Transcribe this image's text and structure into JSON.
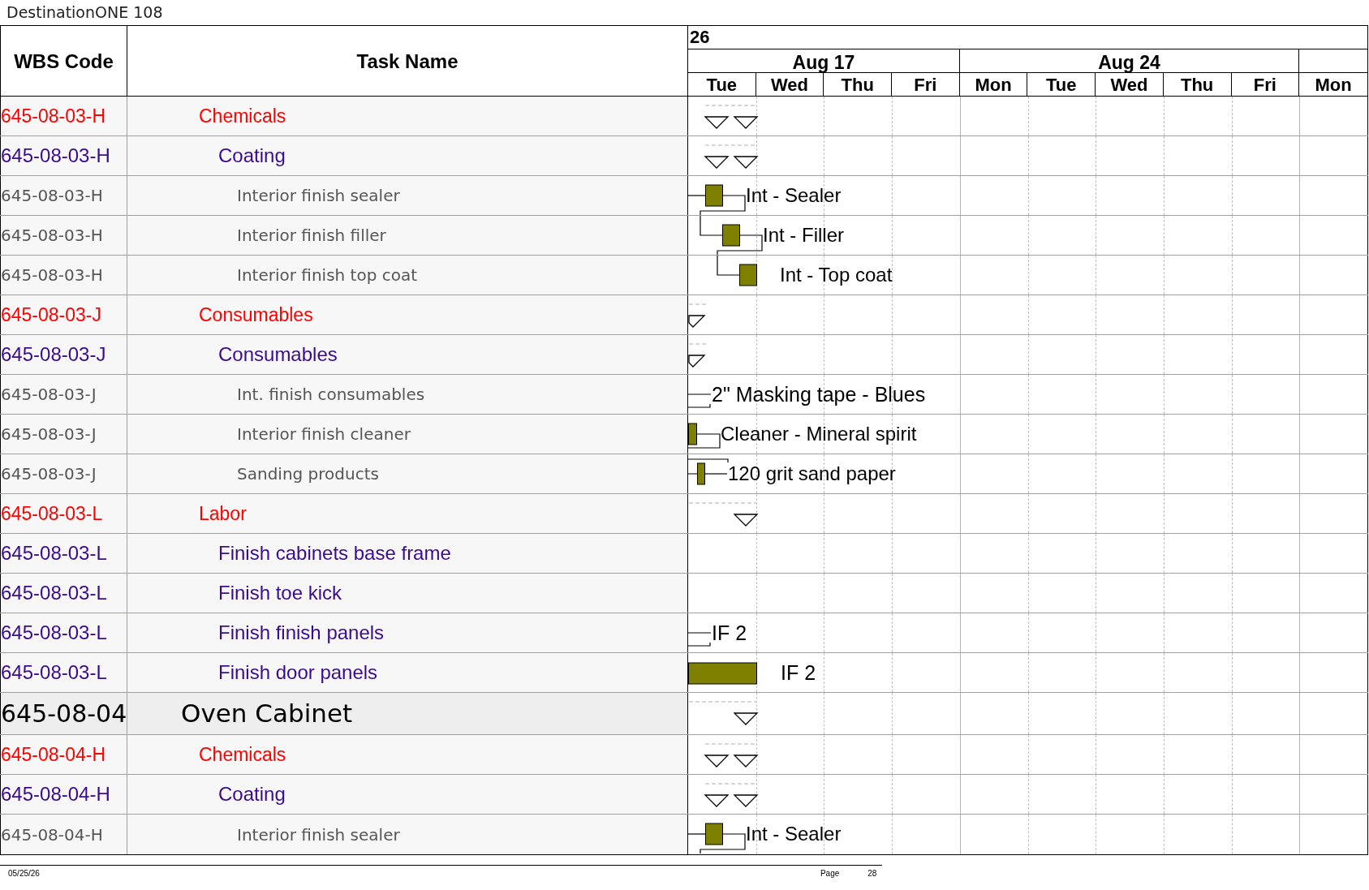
{
  "document": {
    "title": "DestinationONE 108"
  },
  "table": {
    "columns": [
      "WBS Code",
      "Task Name"
    ],
    "timescale": {
      "year": "26",
      "weeks": [
        {
          "label": "Aug 17"
        },
        {
          "label": "Aug 24"
        }
      ],
      "days": [
        "Tue",
        "Wed",
        "Thu",
        "Fri",
        "Mon",
        "Tue",
        "Wed",
        "Thu",
        "Fri",
        "Mon"
      ]
    },
    "rows": [
      {
        "wbs": "645-08-03-H",
        "name": "Chemicals",
        "kind": "group",
        "gantt": {
          "kind": "summary_pair"
        }
      },
      {
        "wbs": "645-08-03-H",
        "name": "Coating",
        "kind": "subgroup",
        "gantt": {
          "kind": "summary_pair"
        }
      },
      {
        "wbs": "645-08-03-H",
        "name": "Interior finish sealer",
        "kind": "task",
        "gantt": {
          "kind": "task",
          "label": "Int - Sealer"
        }
      },
      {
        "wbs": "645-08-03-H",
        "name": "Interior finish filler",
        "kind": "task",
        "gantt": {
          "kind": "task",
          "label": "Int - Filler"
        }
      },
      {
        "wbs": "645-08-03-H",
        "name": "Interior finish top coat",
        "kind": "task",
        "gantt": {
          "kind": "task",
          "label": "Int - Top coat"
        }
      },
      {
        "wbs": "645-08-03-J",
        "name": "Consumables",
        "kind": "group",
        "gantt": {
          "kind": "summary_left"
        }
      },
      {
        "wbs": "645-08-03-J",
        "name": "Consumables",
        "kind": "subgroup",
        "gantt": {
          "kind": "summary_left"
        }
      },
      {
        "wbs": "645-08-03-J",
        "name": "Int. finish consumables",
        "kind": "task",
        "gantt": {
          "kind": "marker",
          "label": "2\" Masking tape - Blues"
        }
      },
      {
        "wbs": "645-08-03-J",
        "name": "Interior finish cleaner",
        "kind": "task",
        "gantt": {
          "kind": "task",
          "label": "Cleaner - Mineral spirit"
        }
      },
      {
        "wbs": "645-08-03-J",
        "name": "Sanding products",
        "kind": "task",
        "gantt": {
          "kind": "task",
          "label": "120 grit sand paper"
        }
      },
      {
        "wbs": "645-08-03-L",
        "name": "Labor",
        "kind": "group",
        "gantt": {
          "kind": "summary_right"
        }
      },
      {
        "wbs": "645-08-03-L",
        "name": "Finish cabinets base frame",
        "kind": "subgroup"
      },
      {
        "wbs": "645-08-03-L",
        "name": "Finish toe kick",
        "kind": "subgroup"
      },
      {
        "wbs": "645-08-03-L",
        "name": "Finish finish panels",
        "kind": "subgroup",
        "gantt": {
          "kind": "marker",
          "label": "IF 2"
        }
      },
      {
        "wbs": "645-08-03-L",
        "name": "Finish door panels",
        "kind": "subgroup",
        "gantt": {
          "kind": "task",
          "label": "IF 2"
        }
      },
      {
        "wbs": "645-08-04",
        "name": "Oven Cabinet",
        "kind": "section",
        "gantt": {
          "kind": "summary_right"
        }
      },
      {
        "wbs": "645-08-04-H",
        "name": "Chemicals",
        "kind": "group",
        "gantt": {
          "kind": "summary_pair"
        }
      },
      {
        "wbs": "645-08-04-H",
        "name": "Coating",
        "kind": "subgroup",
        "gantt": {
          "kind": "summary_pair"
        }
      },
      {
        "wbs": "645-08-04-H",
        "name": "Interior finish sealer",
        "kind": "task",
        "gantt": {
          "kind": "task",
          "label": "Int - Sealer"
        }
      }
    ]
  },
  "footer": {
    "date": "05/25/26",
    "page_label": "Page",
    "page_number": "28"
  }
}
